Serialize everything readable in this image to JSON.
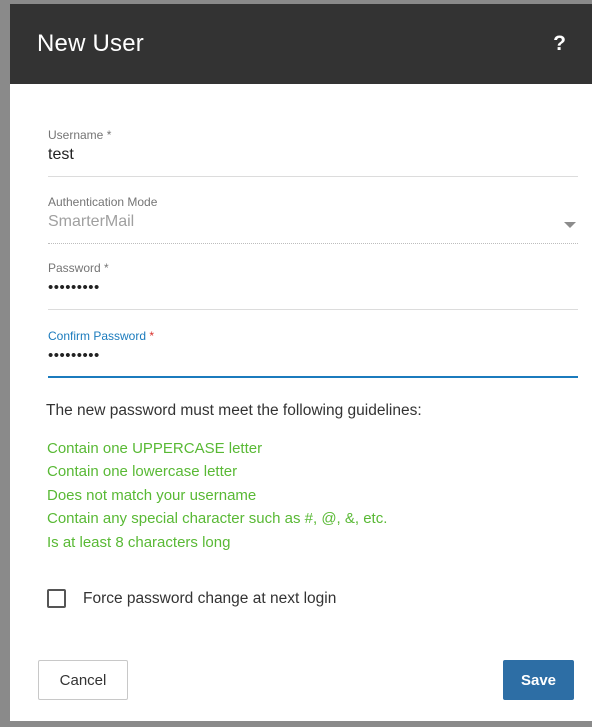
{
  "dialog": {
    "title": "New User",
    "help_label": "?"
  },
  "form": {
    "username": {
      "label": "Username",
      "required_mark": "*",
      "value": "test"
    },
    "auth_mode": {
      "label": "Authentication Mode",
      "value": "SmarterMail"
    },
    "password": {
      "label": "Password",
      "required_mark": "*",
      "value": "•••••••••"
    },
    "confirm_password": {
      "label": "Confirm Password",
      "required_mark": "*",
      "value": "•••••••••"
    }
  },
  "guidelines": {
    "intro": "The new password must meet the following guidelines:",
    "rules": [
      "Contain one UPPERCASE letter",
      "Contain one lowercase letter",
      "Does not match your username",
      "Contain any special character such as #, @, &, etc.",
      "Is at least 8 characters long"
    ]
  },
  "options": {
    "force_change_label": "Force password change at next login"
  },
  "footer": {
    "cancel_label": "Cancel",
    "save_label": "Save"
  },
  "colors": {
    "header_bg": "#333333",
    "accent": "#1b7bbd",
    "rule_ok": "#59b935",
    "save_bg": "#2d6ea5",
    "required": "#d9302c"
  }
}
